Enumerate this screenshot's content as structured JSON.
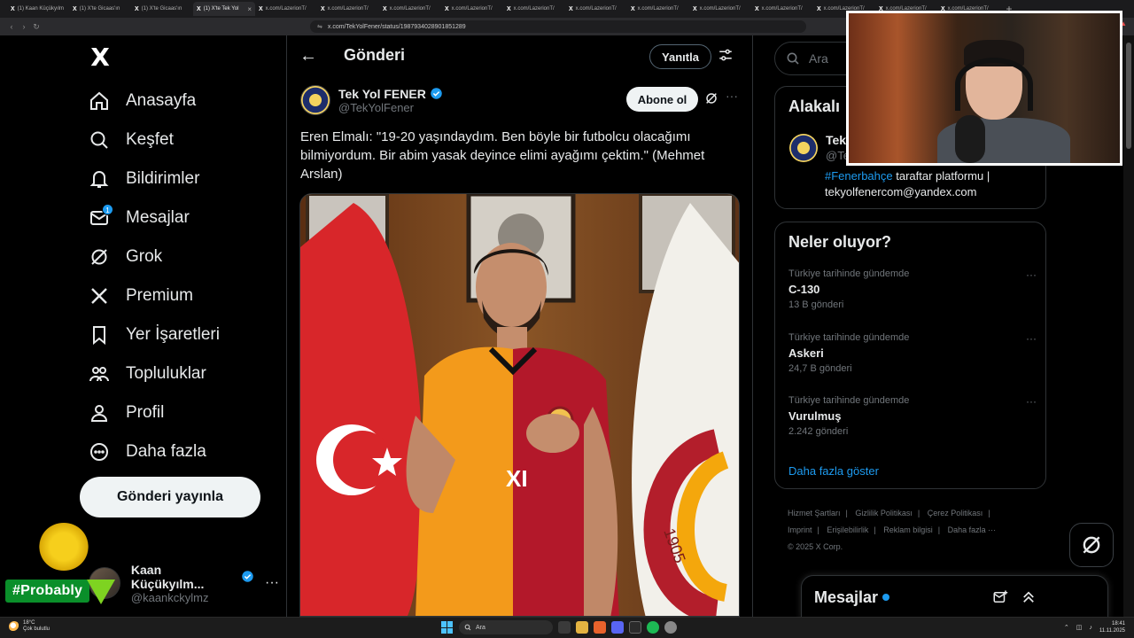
{
  "browser": {
    "tabs": [
      {
        "label": "(1) Kaan Küçükyılm",
        "active": false
      },
      {
        "label": "(1) X'te Gicaas'ın",
        "active": false
      },
      {
        "label": "(1) X'te Gicaas'ın",
        "active": false
      },
      {
        "label": "(1) X'te Tek Yol",
        "active": true
      },
      {
        "label": "x.com/LazerionT/",
        "active": false
      },
      {
        "label": "x.com/LazerionT/",
        "active": false
      },
      {
        "label": "x.com/LazerionT/",
        "active": false
      },
      {
        "label": "x.com/LazerionT/",
        "active": false
      },
      {
        "label": "x.com/LazerionT/",
        "active": false
      },
      {
        "label": "x.com/LazerionT/",
        "active": false
      },
      {
        "label": "x.com/LazerionT/",
        "active": false
      },
      {
        "label": "x.com/LazerionT/",
        "active": false
      },
      {
        "label": "x.com/LazerionT/",
        "active": false
      },
      {
        "label": "x.com/LazerionT/",
        "active": false
      },
      {
        "label": "x.com/LazerionT/",
        "active": false
      },
      {
        "label": "x.com/LazerionT/",
        "active": false
      }
    ],
    "url": "x.com/TekYolFener/status/1987934028901851289"
  },
  "sidebar": {
    "logo": "X",
    "items": [
      {
        "label": "Anasayfa",
        "icon": "home-icon"
      },
      {
        "label": "Keşfet",
        "icon": "search-icon"
      },
      {
        "label": "Bildirimler",
        "icon": "bell-icon"
      },
      {
        "label": "Mesajlar",
        "icon": "mail-icon",
        "badge": "1"
      },
      {
        "label": "Grok",
        "icon": "grok-icon"
      },
      {
        "label": "Premium",
        "icon": "x-icon"
      },
      {
        "label": "Yer İşaretleri",
        "icon": "bookmark-icon"
      },
      {
        "label": "Topluluklar",
        "icon": "communities-icon"
      },
      {
        "label": "Profil",
        "icon": "profile-icon"
      },
      {
        "label": "Daha fazla",
        "icon": "more-circle-icon"
      }
    ],
    "post_button": "Gönderi yayınla",
    "account": {
      "name": "Kaan Küçükyılm...",
      "handle": "@kaankckylmz"
    },
    "overlay_tag": "#Probably"
  },
  "main": {
    "title": "Gönderi",
    "reply_button": "Yanıtla",
    "post": {
      "author_name": "Tek Yol FENER",
      "author_handle": "@TekYolFener",
      "subscribe": "Abone ol",
      "text": "Eren Elmalı: \"19-20 yaşındaydım. Ben böyle bir futbolcu olacağımı bilmiyordum. Bir abim yasak deyince elimi ayağımı çektim.\" (Mehmet Arslan)",
      "jersey_text": "XI",
      "flag_text": "1905"
    }
  },
  "right": {
    "search_placeholder": "Ara",
    "related": {
      "title": "Alakalı",
      "name": "Tek",
      "handle": "@Te",
      "bio_tag": "#Fenerbahçe",
      "bio_rest": " taraftar platformu | tekyolfenercom@yandex.com"
    },
    "trends": {
      "title": "Neler oluyor?",
      "items": [
        {
          "context": "Türkiye tarihinde gündemde",
          "name": "C-130",
          "count": "13 B gönderi"
        },
        {
          "context": "Türkiye tarihinde gündemde",
          "name": "Askeri",
          "count": "24,7 B gönderi"
        },
        {
          "context": "Türkiye tarihinde gündemde",
          "name": "Vurulmuş",
          "count": "2.242 gönderi"
        }
      ],
      "show_more": "Daha fazla göster"
    },
    "footer": {
      "links": [
        "Hizmet Şartları",
        "Gizlilik Politikası",
        "Çerez Politikası",
        "Imprint",
        "Erişilebilirlik",
        "Reklam bilgisi",
        "Daha fazla ···"
      ],
      "copyright": "© 2025 X Corp."
    },
    "messages_label": "Mesajlar"
  },
  "taskbar": {
    "weather_temp": "18°C",
    "weather_desc": "Çok bulutlu",
    "search_label": "Ara",
    "time": "18:41",
    "date": "11.11.2025"
  },
  "colors": {
    "accent": "#1d9bf0",
    "background": "#000000",
    "border": "#2f3336",
    "muted": "#71767b",
    "probably_green": "#0a8f2a"
  }
}
